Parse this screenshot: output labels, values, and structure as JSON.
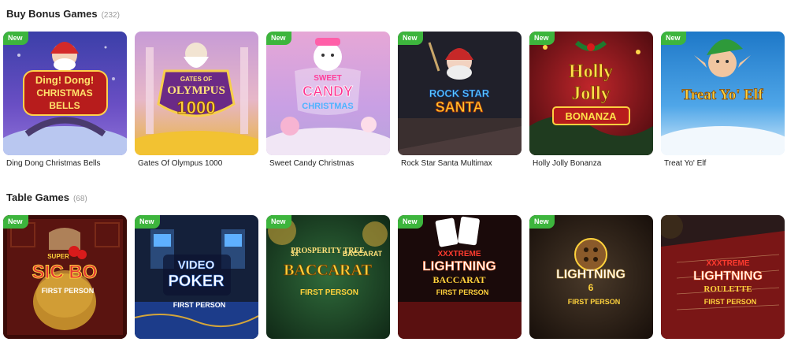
{
  "sections": {
    "bonus": {
      "title": "Buy Bonus Games",
      "count": "(232)",
      "games": [
        {
          "name": "Ding Dong Christmas Bells",
          "badge": "New",
          "logo": [
            "Ding! Dong!",
            "CHRISTMAS",
            "BELLS"
          ]
        },
        {
          "name": "Gates Of Olympus 1000",
          "badge": "",
          "logo": [
            "GATES OF",
            "OLYMPUS",
            "1000"
          ]
        },
        {
          "name": "Sweet Candy Christmas",
          "badge": "New",
          "logo": [
            "SWEET",
            "CANDY",
            "CHRISTMAS"
          ]
        },
        {
          "name": "Rock Star Santa Multimax",
          "badge": "New",
          "logo": [
            "ROCK STAR",
            "SANTA"
          ]
        },
        {
          "name": "Holly Jolly Bonanza",
          "badge": "New",
          "logo": [
            "Holly",
            "Jolly",
            "BONANZA"
          ]
        },
        {
          "name": "Treat Yo' Elf",
          "badge": "New",
          "logo": [
            "Treat Yo' Elf"
          ]
        }
      ]
    },
    "table": {
      "title": "Table Games",
      "count": "(68)",
      "games": [
        {
          "badge": "New",
          "logo": [
            "SUPER",
            "SIC BO",
            "FIRST PERSON"
          ]
        },
        {
          "badge": "New",
          "logo": [
            "VIDEO",
            "POKER",
            "FIRST PERSON"
          ]
        },
        {
          "badge": "New",
          "logo": [
            "3x",
            "PROSPERITY TREE",
            "2x",
            "BACCARAT",
            "FIRST PERSON"
          ]
        },
        {
          "badge": "New",
          "logo": [
            "XXXTREME",
            "LIGHTNING",
            "BACCARAT",
            "FIRST PERSON"
          ]
        },
        {
          "badge": "New",
          "logo": [
            "LIGHTNING",
            "6",
            "FIRST PERSON"
          ]
        },
        {
          "badge": "",
          "logo": [
            "XXXTREME",
            "LIGHTNING",
            "ROULETTE",
            "FIRST PERSON"
          ]
        }
      ]
    }
  },
  "colors": {
    "new_badge": "#3db53d",
    "text": "#222222",
    "count": "#9a9a9a"
  }
}
